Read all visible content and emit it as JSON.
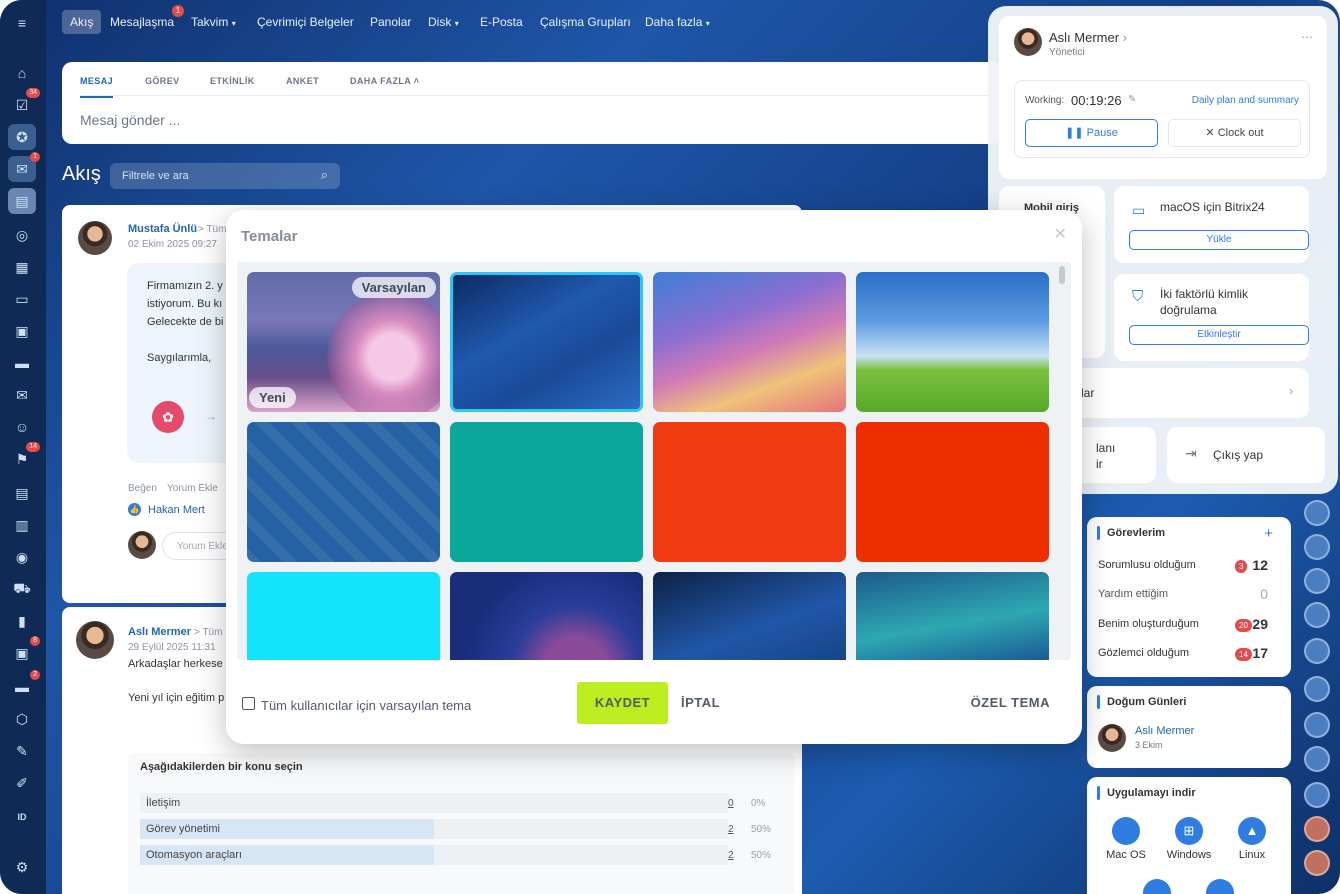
{
  "topnav": {
    "items": [
      "Akış",
      "Mesajlaşma",
      "Takvim",
      "Çevrimiçi Belgeler",
      "Panolar",
      "Disk",
      "E-Posta",
      "Çalışma Grupları",
      "Daha fazla"
    ],
    "messages_badge": "1"
  },
  "leftbar": {
    "badges": {
      "tasks": "34",
      "chat": "1",
      "feed": "14",
      "crm": "8",
      "shop": "2"
    },
    "id_label": "ID"
  },
  "composer": {
    "tabs": [
      "MESAJ",
      "GÖREV",
      "ETKİNLİK",
      "ANKET",
      "DAHA FAZLA"
    ],
    "placeholder": "Mesaj gönder ..."
  },
  "feed": {
    "title": "Akış",
    "filter_placeholder": "Filtrele ve ara"
  },
  "post1": {
    "author": "Mustafa Ünlü",
    "recipients": "Tüm",
    "date": "02 Ekim 2025 09:27",
    "lines": [
      "Firmamızın 2. y",
      "istiyorum. Bu kı",
      "Gelecekte de bi",
      "",
      "Saygılarımla,"
    ],
    "like": "Beğen",
    "comment": "Yorum Ekle",
    "liker": "Hakan Mert",
    "comment_placeholder": "Yorum Ekle"
  },
  "post2": {
    "author": "Aslı Mermer",
    "recipients": "Tüm",
    "date": "29 Eylül 2025 11:31",
    "line1": "Arkadaşlar herkese",
    "line2": "Yeni yıl için eğitim p",
    "poll_title": "Aşağıdakilerden bir konu seçin",
    "poll": [
      {
        "label": "İletişim",
        "count": "0",
        "pct": "0%",
        "frac": 0
      },
      {
        "label": "Görev yönetimi",
        "count": "2",
        "pct": "50%",
        "frac": 0.5
      },
      {
        "label": "Otomasyon araçları",
        "count": "2",
        "pct": "50%",
        "frac": 0.5
      }
    ]
  },
  "profile": {
    "name": "Aslı Mermer",
    "role": "Yönetici",
    "working_label": "Working:",
    "timer": "00:19:26",
    "daily": "Daily plan and summary",
    "pause": "Pause",
    "clockout": "Clock out"
  },
  "rightcards": {
    "mobile": "Mobil giriş",
    "macos": "macOS için Bitrix24",
    "install": "Yükle",
    "twofa": "İki faktörlü kimlik doğrulama",
    "enable": "Etkinleştir",
    "row1": "lar",
    "row2a": "lanı",
    "row2b": "ir",
    "logout": "Çıkış yap"
  },
  "tasks": {
    "title": "Görevlerim",
    "add": "+",
    "rows": [
      {
        "label": "Sorumlusu olduğum",
        "badge": "3",
        "count": "12"
      },
      {
        "label": "Yardım ettiğim",
        "badge": "",
        "count": "0"
      },
      {
        "label": "Benim oluşturduğum",
        "badge": "20",
        "count": "29"
      },
      {
        "label": "Gözlemci olduğum",
        "badge": "14",
        "count": "17"
      }
    ]
  },
  "birthdays": {
    "title": "Doğum Günleri",
    "name": "Aslı Mermer",
    "date": "3 Ekim"
  },
  "apps": {
    "title": "Uygulamayı indir",
    "items": [
      "Mac OS",
      "Windows",
      "Linux"
    ]
  },
  "modal": {
    "title": "Temalar",
    "tag_default": "Varsayılan",
    "tag_new": "Yeni",
    "checkbox_label": "Tüm kullanıcılar için varsayılan tema",
    "save": "KAYDET",
    "cancel": "İPTAL",
    "custom": "ÖZEL TEMA"
  },
  "icons": {
    "close": "close-icon",
    "search": "search-icon",
    "menu": "hamburger-icon"
  }
}
